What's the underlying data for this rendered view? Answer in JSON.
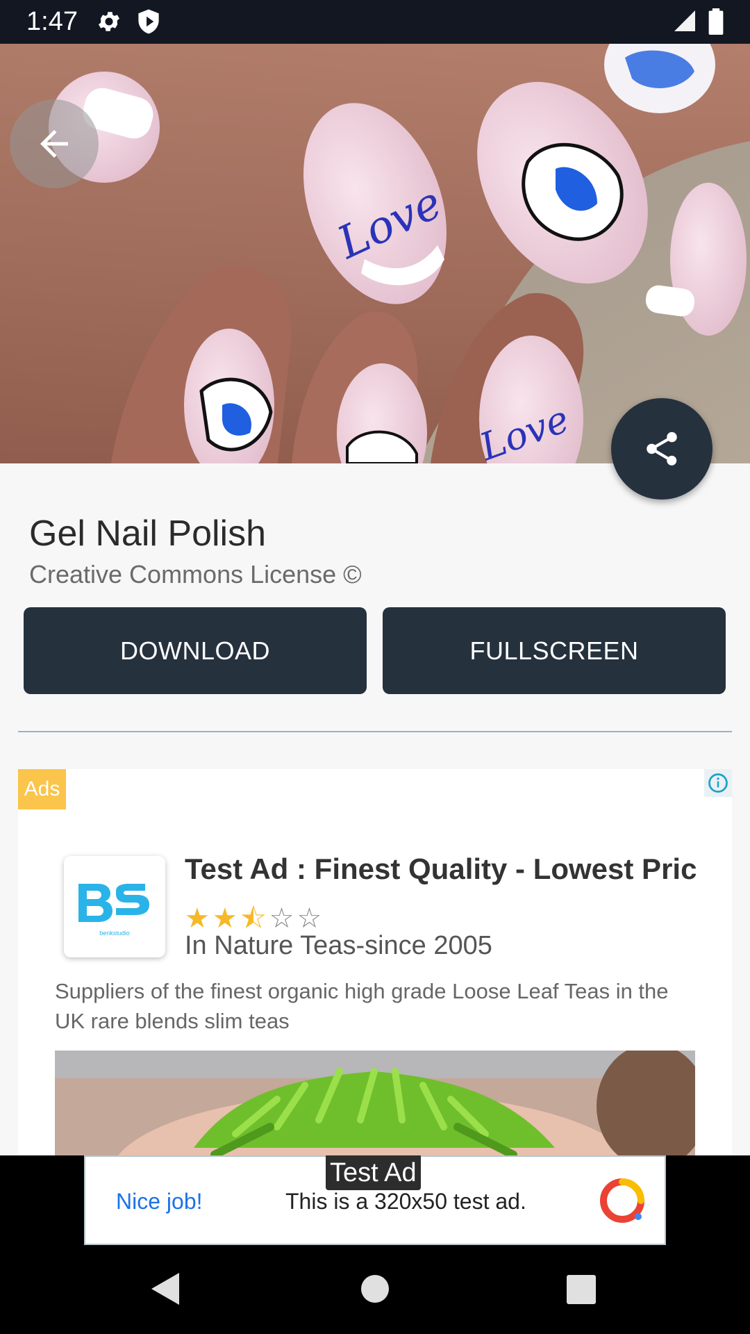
{
  "status_bar": {
    "time": "1:47",
    "icons": [
      "gear-icon",
      "shield-icon",
      "signal-icon",
      "battery-icon"
    ]
  },
  "hero": {
    "image_description_icon": "nail-art-photo",
    "back_icon": "back-arrow-icon",
    "share_icon": "share-icon"
  },
  "detail": {
    "title": "Gel Nail Polish",
    "license": "Creative Commons License ©",
    "download_label": "DOWNLOAD",
    "fullscreen_label": "FULLSCREEN"
  },
  "ad": {
    "badge": "Ads",
    "headline": "Test Ad : Finest Quality - Lowest Prices",
    "rating": 2.5,
    "rating_max": 5,
    "stars": {
      "full": "★★",
      "half": "⯪",
      "empty": "☆☆"
    },
    "advertiser": "In Nature Teas-since 2005",
    "body": "Suppliers of the finest organic high grade Loose Leaf Teas in the UK rare blends slim teas",
    "logo_text": "benkstudio"
  },
  "banner": {
    "tag": "Test Ad",
    "nice": "Nice job!",
    "text": "This is a 320x50 test ad."
  },
  "colors": {
    "status_bar": "#131722",
    "button": "#26313e",
    "ads_badge": "#fbc44a",
    "accent_blue": "#1a73e8",
    "star": "#f5b828"
  }
}
